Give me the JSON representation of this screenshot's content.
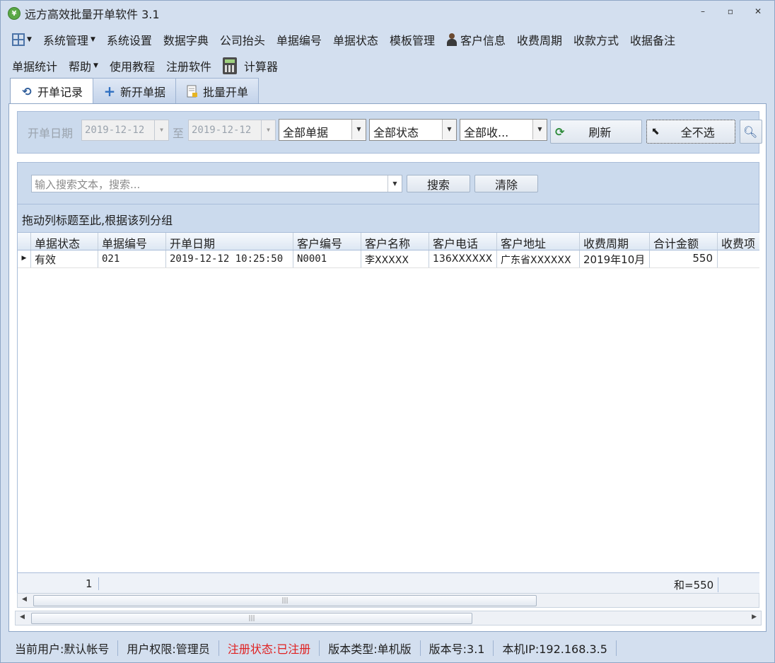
{
  "window": {
    "title": "远方高效批量开单软件 3.1"
  },
  "menu": {
    "row1": [
      "系统管理",
      "系统设置",
      "数据字典",
      "公司抬头",
      "单据编号",
      "单据状态",
      "模板管理",
      "客户信息",
      "收费周期",
      "收款方式",
      "收据备注"
    ],
    "row2": [
      "单据统计",
      "帮助",
      "使用教程",
      "注册软件",
      "计算器"
    ]
  },
  "tabs": [
    "开单记录",
    "新开单据",
    "批量开单"
  ],
  "filter": {
    "date_label": "开单日期",
    "date_from": "2019-12-12",
    "to_label": "至",
    "date_to": "2019-12-12",
    "doc_filter": "全部单据",
    "status_filter": "全部状态",
    "period_filter": "全部收...",
    "refresh_label": "刷新",
    "deselect_label": "全不选"
  },
  "search": {
    "placeholder": "输入搜索文本，搜索...",
    "search_label": "搜索",
    "clear_label": "清除"
  },
  "group_hint": "拖动列标题至此,根据该列分组",
  "table": {
    "columns": [
      "单据状态",
      "单据编号",
      "开单日期",
      "客户编号",
      "客户名称",
      "客户电话",
      "客户地址",
      "收费周期",
      "合计金额",
      "收费项"
    ],
    "rows": [
      [
        "有效",
        "021",
        "2019-12-12 10:25:50",
        "N0001",
        "李XXXXX",
        "136XXXXXX",
        "广东省XXXXXX",
        "2019年10月",
        "550",
        ""
      ]
    ],
    "footer_count": "1",
    "footer_sum": "和=550"
  },
  "status": {
    "user": "当前用户:默认帐号",
    "role": "用户权限:管理员",
    "reg": "注册状态:已注册",
    "edition": "版本类型:单机版",
    "version": "版本号:3.1",
    "ip": "本机IP:192.168.3.5"
  },
  "colors": {
    "reg_status": "#e02020",
    "accent": "#4c74a8"
  }
}
